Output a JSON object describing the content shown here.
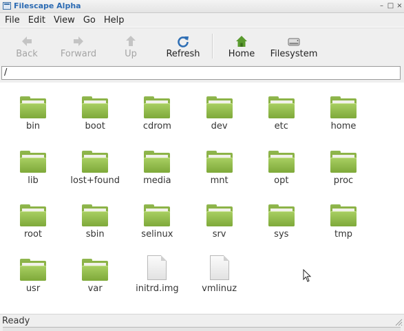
{
  "window": {
    "title": "Filescape Alpha",
    "minimize_glyph": "–",
    "maximize_glyph": "□",
    "close_glyph": "×"
  },
  "menu": [
    "File",
    "Edit",
    "View",
    "Go",
    "Help"
  ],
  "toolbar": {
    "back": "Back",
    "forward": "Forward",
    "up": "Up",
    "refresh": "Refresh",
    "home": "Home",
    "filesystem": "Filesystem"
  },
  "location": {
    "path": "/"
  },
  "items": [
    {
      "name": "bin",
      "type": "folder"
    },
    {
      "name": "boot",
      "type": "folder"
    },
    {
      "name": "cdrom",
      "type": "folder"
    },
    {
      "name": "dev",
      "type": "folder"
    },
    {
      "name": "etc",
      "type": "folder"
    },
    {
      "name": "home",
      "type": "folder"
    },
    {
      "name": "lib",
      "type": "folder"
    },
    {
      "name": "lost+found",
      "type": "folder"
    },
    {
      "name": "media",
      "type": "folder"
    },
    {
      "name": "mnt",
      "type": "folder"
    },
    {
      "name": "opt",
      "type": "folder"
    },
    {
      "name": "proc",
      "type": "folder"
    },
    {
      "name": "root",
      "type": "folder"
    },
    {
      "name": "sbin",
      "type": "folder"
    },
    {
      "name": "selinux",
      "type": "folder"
    },
    {
      "name": "srv",
      "type": "folder"
    },
    {
      "name": "sys",
      "type": "folder"
    },
    {
      "name": "tmp",
      "type": "folder"
    },
    {
      "name": "usr",
      "type": "folder"
    },
    {
      "name": "var",
      "type": "folder"
    },
    {
      "name": "initrd.img",
      "type": "file"
    },
    {
      "name": "vmlinuz",
      "type": "file"
    }
  ],
  "status": {
    "text": "Ready"
  },
  "colors": {
    "title_text": "#2c6bb3",
    "folder": "#8cb347",
    "refresh_icon": "#2f6fb5",
    "home_icon": "#5a9a2e"
  }
}
